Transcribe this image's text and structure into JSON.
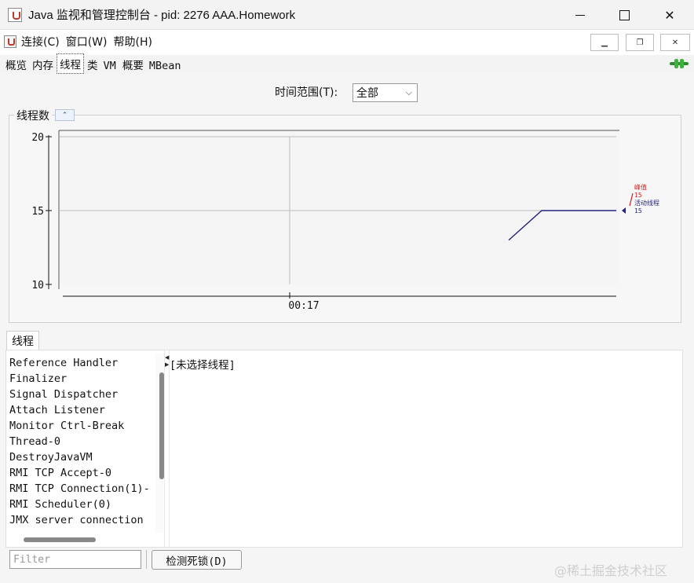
{
  "window": {
    "title": "Java 监视和管理控制台 - pid: 2276 AAA.Homework"
  },
  "menu": {
    "items": [
      "连接(C)",
      "窗口(W)",
      "帮助(H)"
    ]
  },
  "tabs": [
    {
      "label": "概览",
      "active": false
    },
    {
      "label": "内存",
      "active": false
    },
    {
      "label": "线程",
      "active": true
    },
    {
      "label": "类",
      "active": false
    },
    {
      "label": "VM 概要",
      "active": false
    },
    {
      "label": "MBean",
      "active": false
    }
  ],
  "time_range": {
    "label": "时间范围(T):",
    "value": "全部"
  },
  "thread_chart": {
    "panel_title": "线程数",
    "legend": {
      "peak_label": "峰值",
      "peak_value": "15",
      "live_label": "活动线程",
      "live_value": "15"
    }
  },
  "chart_data": {
    "type": "line",
    "title": "线程数",
    "xlabel": "",
    "ylabel": "",
    "x_tick_labels": [
      "00:17"
    ],
    "y_ticks": [
      10,
      15,
      20
    ],
    "ylim": [
      10,
      20
    ],
    "grid": true,
    "colors": {
      "peak": "#d62020",
      "live": "#23237e"
    },
    "series": [
      {
        "name": "活动线程",
        "values": [
          13,
          15,
          15
        ]
      }
    ]
  },
  "threads": {
    "tab_label": "线程",
    "items": [
      "Reference Handler",
      "Finalizer",
      "Signal Dispatcher",
      "Attach Listener",
      "Monitor Ctrl-Break",
      "Thread-0",
      "DestroyJavaVM",
      "RMI TCP Accept-0",
      "RMI TCP Connection(1)-",
      "RMI Scheduler(0)",
      "JMX server connection"
    ],
    "detail_text": "[未选择线程]",
    "filter_placeholder": "Filter",
    "deadlock_button": "检测死锁(D)"
  },
  "watermark": "@稀土掘金技术社区"
}
